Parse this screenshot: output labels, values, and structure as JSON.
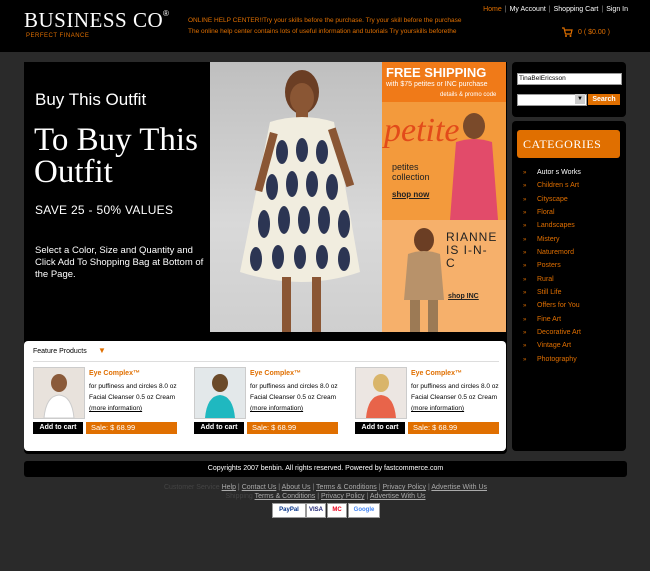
{
  "header": {
    "logo": "BUSINESS CO",
    "logo_mark": "®",
    "tagline": "PERFECT FINANCE",
    "help_line1": "ONLINE HELP CENTER!!Try your skills before the purchase. Try your skill before the purchase",
    "help_line2": "The online help center contains lots of useful information and tutorials Try yourskills beforethe",
    "nav": [
      "Home",
      "My Account",
      "Shopping Cart",
      "Sign In"
    ],
    "cart_summary": "0  ( $0.00 )"
  },
  "hero": {
    "line1": "Buy This Outfit",
    "line2": "To Buy This Outfit",
    "line3": "SAVE  25 - 50%  VALUES",
    "line4": "Select a Color, Size and Quantity and Click Add To Shopping Bag at Bottom of the Page."
  },
  "promo": {
    "free_shipping": "FREE SHIPPING",
    "sub": "with $75 petites or INC purchase",
    "promo_code": "details & promo code",
    "petites": "petite",
    "petites_collection": "petites collection",
    "shop_now": "shop now",
    "rianne": "RIANNE IS I-N-C",
    "shop_inc": "shop INC"
  },
  "feature": {
    "title": "Feature  Products",
    "products": [
      {
        "title": "Eye Complex™",
        "desc1": "for puffiness and circles 8.0 oz",
        "desc2": "Facial Cleanser 0.5 oz Cream",
        "more": "(more information)",
        "add": "Add to cart",
        "sale": "Sale:   $ 68.99"
      },
      {
        "title": "Eye Complex™",
        "desc1": "for puffiness and circles 8.0 oz",
        "desc2": "Facial Cleanser 0.5 oz Cream",
        "more": "(more information)",
        "add": "Add to cart",
        "sale": "Sale:   $ 68.99"
      },
      {
        "title": "Eye Complex™",
        "desc1": "for puffiness and circles 8.0 oz",
        "desc2": "Facial Cleanser 0.5 oz Cream",
        "more": "(more information)",
        "add": "Add to cart",
        "sale": "Sale:   $ 68.99"
      }
    ]
  },
  "search": {
    "value": "TinaBelEricsson",
    "button": "Search"
  },
  "categories": {
    "title": "CATEGORIES",
    "items": [
      "Autor s Works",
      "Children s Art",
      "Cityscape",
      "Floral",
      "Landscapes",
      "Mistery",
      "Naturemord",
      "Posters",
      "Rural",
      "Still Life",
      "Offers for You",
      "Fine Art",
      "Decorative Art",
      "Vintage Art",
      "Photography"
    ]
  },
  "footer": {
    "copyright": "Copyrights 2007 benbin. All rights reserved.     Powered by fastcommerce.com",
    "links1_ghost": "Customer Service",
    "links1": [
      "Help",
      "Contact Us",
      "About Us",
      "Terms & Conditions",
      "Privacy Policy",
      "Advertise With Us"
    ],
    "links2_ghost": "Shipping",
    "links2": [
      "Terms & Conditions",
      "Privacy Policy",
      "Advertise With Us"
    ],
    "badges": [
      "PayPal",
      "VISA",
      "MC",
      "Google"
    ]
  },
  "colors": {
    "accent": "#e06f00",
    "background": "#2a2a2a",
    "panel": "#000000"
  }
}
